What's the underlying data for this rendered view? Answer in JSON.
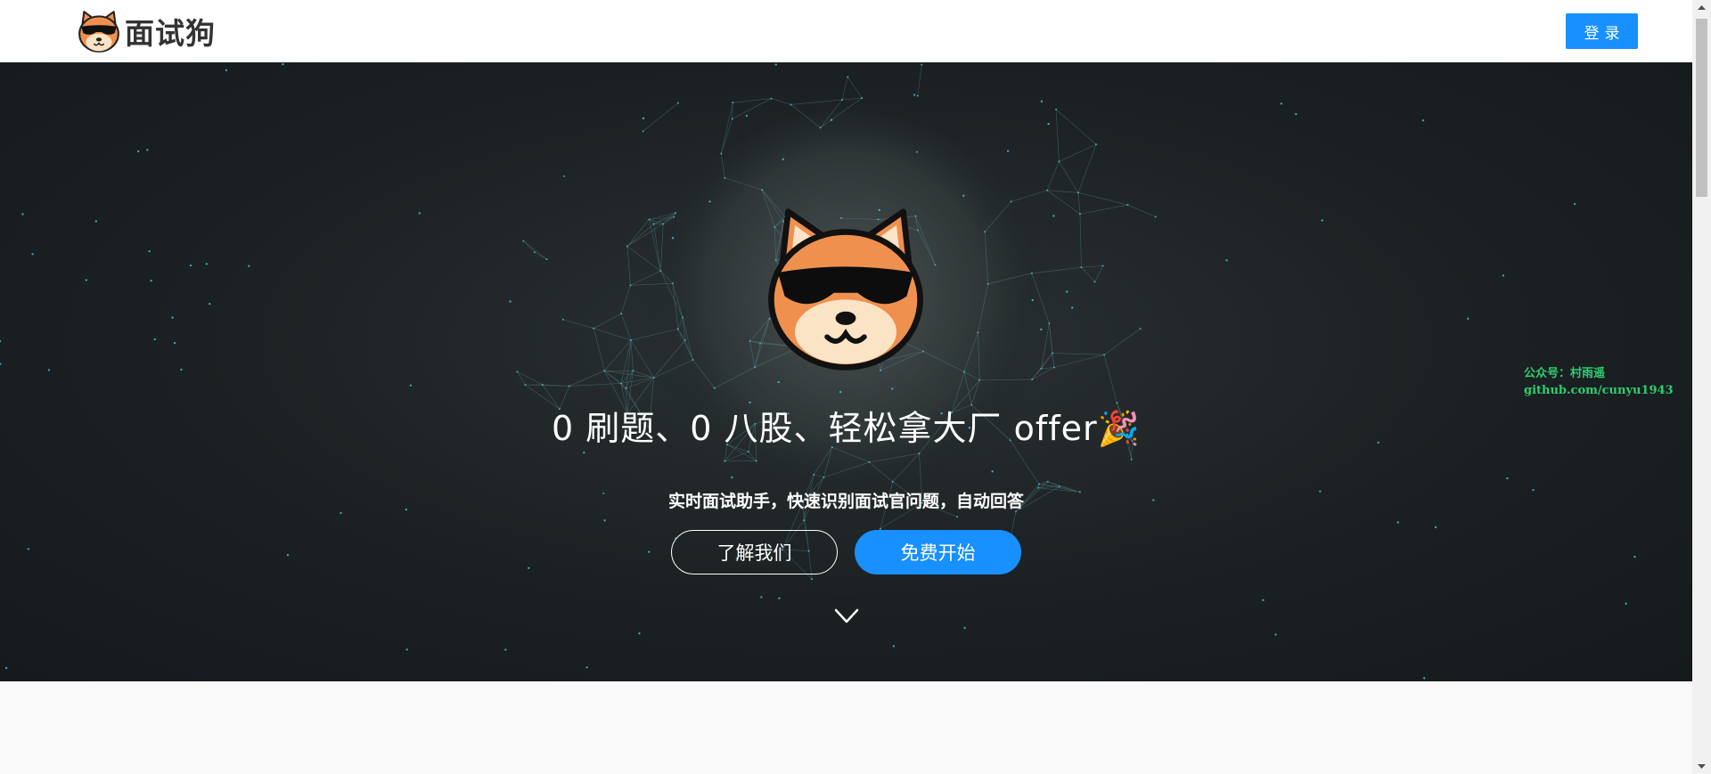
{
  "header": {
    "brand_name": "面试狗",
    "login_label": "登录"
  },
  "hero": {
    "title": "0 刷题、0 八股、轻松拿大厂 offer🎉",
    "subtitle": "实时面试助手，快速识别面试官问题，自动回答",
    "about_label": "了解我们",
    "start_label": "免费开始",
    "watermark_line1": "公众号：村雨遥",
    "watermark_line2": "github.com/cunyu1943"
  },
  "colors": {
    "accent": "#1890ff",
    "hero_bg": "#1b2022",
    "watermark": "#2ecc71",
    "shiba_orange": "#f0904e",
    "shiba_cream": "#fbe3c6"
  },
  "icons": {
    "brand_logo": "shiba-sunglasses-icon",
    "scroll_down": "chevron-down-icon"
  }
}
